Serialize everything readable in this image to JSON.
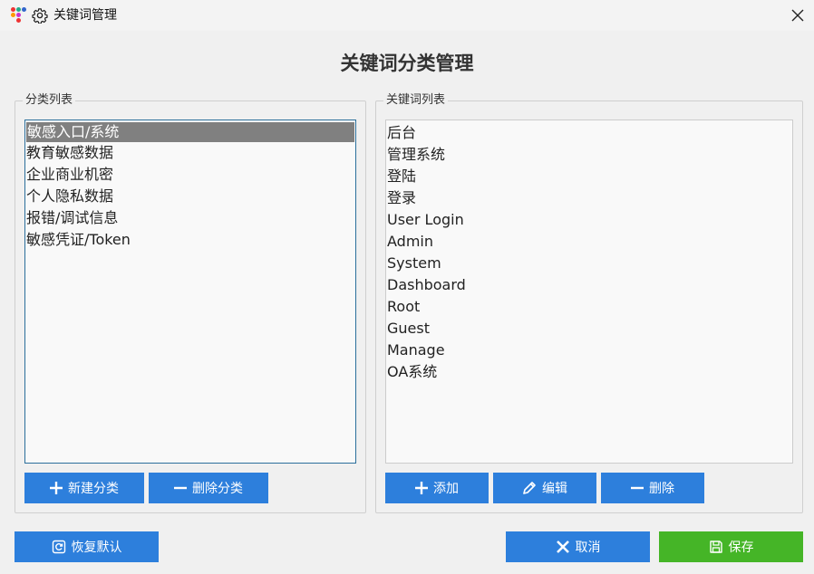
{
  "window": {
    "title": "关键词管理",
    "heading": "关键词分类管理"
  },
  "categories": {
    "legend": "分类列表",
    "items": [
      "敏感入口/系统",
      "教育敏感数据",
      "企业商业机密",
      "个人隐私数据",
      "报错/调试信息",
      "敏感凭证/Token"
    ],
    "selected": "敏感入口/系统",
    "add_label": "新建分类",
    "delete_label": "删除分类"
  },
  "keywords": {
    "legend": "关键词列表",
    "items": [
      "后台",
      "管理系统",
      "登陆",
      "登录",
      "User Login",
      "Admin",
      "System",
      "Dashboard",
      "Root",
      "Guest",
      "Manage",
      "OA系统"
    ],
    "add_label": "添加",
    "edit_label": "编辑",
    "delete_label": "删除"
  },
  "footer": {
    "restore_label": "恢复默认",
    "cancel_label": "取消",
    "save_label": "保存"
  },
  "colors": {
    "primary_button": "#2d7fdc",
    "save_button": "#45b527",
    "selection": "#808080",
    "list_focus_border": "#2b6f9b"
  },
  "icons": [
    "app-logo-icon",
    "gear-icon",
    "close-icon",
    "plus-icon",
    "minus-icon",
    "pencil-icon",
    "restore-icon",
    "x-icon",
    "save-icon"
  ]
}
